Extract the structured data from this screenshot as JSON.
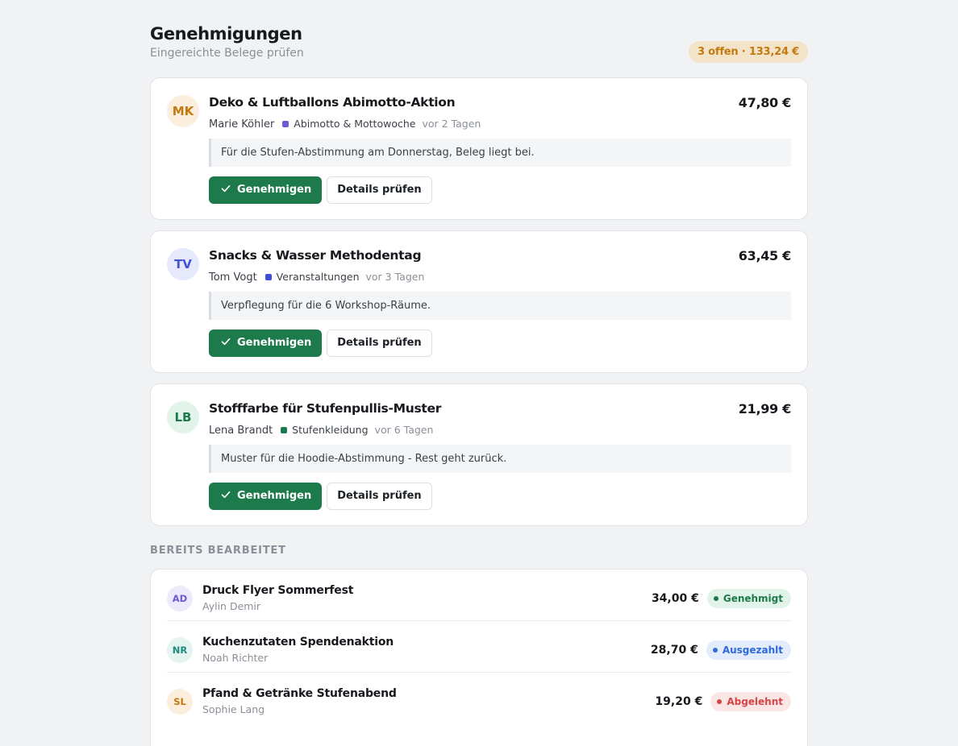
{
  "header": {
    "title": "Genehmigungen",
    "subtitle": "Eingereichte Belege prüfen",
    "summary": "3 offen · 133,24 €"
  },
  "buttons": {
    "approve": "Genehmigen",
    "details": "Details prüfen"
  },
  "pending": [
    {
      "initials": "MK",
      "avatar_bg": "#fbeedd",
      "avatar_fg": "#c27a0e",
      "title": "Deko & Luftballons Abimotto-Aktion",
      "amount": "47,80 €",
      "person": "Marie Köhler",
      "category": "Abimotto & Mottowoche",
      "category_color": "#6b5bd6",
      "time": "vor 2 Tagen",
      "note": "Für die Stufen-Abstimmung am Donnerstag, Beleg liegt bei."
    },
    {
      "initials": "TV",
      "avatar_bg": "#e6e9fb",
      "avatar_fg": "#4452d6",
      "title": "Snacks & Wasser Methodentag",
      "amount": "63,45 €",
      "person": "Tom Vogt",
      "category": "Veranstaltungen",
      "category_color": "#3b4fd8",
      "time": "vor 3 Tagen",
      "note": "Verpflegung für die 6 Workshop-Räume."
    },
    {
      "initials": "LB",
      "avatar_bg": "#e2f3ea",
      "avatar_fg": "#1c7a4b",
      "title": "Stofffarbe für Stufenpullis-Muster",
      "amount": "21,99 €",
      "person": "Lena Brandt",
      "category": "Stufenkleidung",
      "category_color": "#1c7a4b",
      "time": "vor 6 Tagen",
      "note": "Muster für die Hoodie-Abstimmung - Rest geht zurück."
    }
  ],
  "processed": {
    "label": "BEREITS BEARBEITET",
    "items": [
      {
        "initials": "AD",
        "avatar_bg": "#eeeafb",
        "avatar_fg": "#6b5bd6",
        "title": "Druck Flyer Sommerfest",
        "person": "Aylin Demir",
        "amount": "34,00 €",
        "status": "Genehmigt",
        "status_bg": "#e2f3ea",
        "status_fg": "#1c7a4b"
      },
      {
        "initials": "NR",
        "avatar_bg": "#e3f4f1",
        "avatar_fg": "#1b8c7a",
        "title": "Kuchenzutaten Spendenaktion",
        "person": "Noah Richter",
        "amount": "28,70 €",
        "status": "Ausgezahlt",
        "status_bg": "#e3ecfb",
        "status_fg": "#2f6ad8"
      },
      {
        "initials": "SL",
        "avatar_bg": "#fbeedd",
        "avatar_fg": "#c27a0e",
        "title": "Pfand & Getränke Stufenabend",
        "person": "Sophie Lang",
        "amount": "19,20 €",
        "status": "Abgelehnt",
        "status_bg": "#fbe6e6",
        "status_fg": "#d64545"
      }
    ]
  }
}
